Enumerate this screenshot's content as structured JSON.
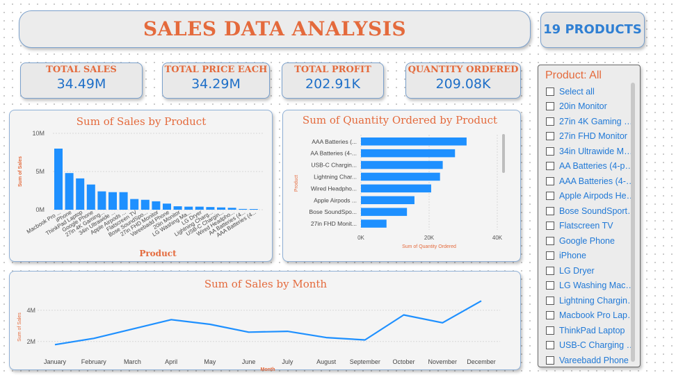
{
  "header": {
    "title": "SALES DATA ANALYSIS",
    "product_count": "19 PRODUCTS"
  },
  "kpis": [
    {
      "label": "TOTAL SALES",
      "value": "34.49M"
    },
    {
      "label": "TOTAL PRICE EACH",
      "value": "34.29M"
    },
    {
      "label": "TOTAL PROFIT",
      "value": "202.91K"
    },
    {
      "label": "QUANTITY ORDERED",
      "value": "209.08K"
    }
  ],
  "slicer": {
    "title": "Product: All",
    "items": [
      "Select all",
      "20in Monitor",
      "27in 4K Gaming Mo...",
      "27in FHD Monitor",
      "34in Ultrawide Mon...",
      "AA Batteries (4-pack)",
      "AAA Batteries (4-pa...",
      "Apple Airpods Hea...",
      "Bose SoundSport H...",
      "Flatscreen TV",
      "Google Phone",
      "iPhone",
      "LG Dryer",
      "LG Washing Machine",
      "Lightning Charging ...",
      "Macbook Pro Laptop",
      "ThinkPad Laptop",
      "USB-C Charging Ca...",
      "Vareebadd Phone"
    ]
  },
  "colors": {
    "accent": "#e46a3c",
    "bar": "#1e90ff",
    "value": "#1e6fc8"
  },
  "chart_data": [
    {
      "type": "bar",
      "title": "Sum of Sales by Product",
      "xlabel": "Product",
      "ylabel": "Sum of Sales",
      "ylim": [
        0,
        10000000
      ],
      "yticks": [
        "0M",
        "5M",
        "10M"
      ],
      "ytick_values": [
        0,
        5000000,
        10000000
      ],
      "categories": [
        "Macbook Pro ...",
        "iPhone",
        "ThinkPad Laptop",
        "Google Phone",
        "27in 4K Gaming...",
        "34in Ultrawide ...",
        "Apple Airpods ...",
        "Flatscreen TV",
        "Bose SoundSpo...",
        "27in FHD Monitor",
        "Vareebadd Phone",
        "20in Monitor",
        "LG Washing Ma...",
        "LG Dryer",
        "Lightning Charg...",
        "USB-C Chargin...",
        "Wired Headpho...",
        "AA Batteries (4...",
        "AAA Batteries (4..."
      ],
      "values": [
        8000000,
        4800000,
        4100000,
        3300000,
        2400000,
        2300000,
        2300000,
        1400000,
        1300000,
        1100000,
        800000,
        450000,
        400000,
        400000,
        350000,
        300000,
        250000,
        100000,
        90000
      ]
    },
    {
      "type": "bar",
      "orientation": "horizontal",
      "title": "Sum of Quantity Ordered by Product",
      "xlabel": "Sum of Quantity Ordered",
      "ylabel": "Product",
      "xlim": [
        0,
        40000
      ],
      "xticks": [
        "0K",
        "20K",
        "40K"
      ],
      "xtick_values": [
        0,
        20000,
        40000
      ],
      "categories": [
        "AAA Batteries (...",
        "AA Batteries (4-...",
        "USB-C Chargin...",
        "Lightning Char...",
        "Wired Headpho...",
        "Apple Airpods ...",
        "Bose SoundSpo...",
        "27in FHD Monit..."
      ],
      "values": [
        31000,
        27600,
        24000,
        23200,
        20600,
        15700,
        13500,
        7500
      ]
    },
    {
      "type": "line",
      "title": "Sum of Sales by Month",
      "xlabel": "Month",
      "ylabel": "Sum of Sales",
      "ylim": [
        1500000,
        4700000
      ],
      "yticks": [
        "2M",
        "4M"
      ],
      "ytick_values": [
        2000000,
        4000000
      ],
      "x": [
        "January",
        "February",
        "March",
        "April",
        "May",
        "June",
        "July",
        "August",
        "September",
        "October",
        "November",
        "December"
      ],
      "values": [
        1800000,
        2200000,
        2800000,
        3400000,
        3100000,
        2600000,
        2650000,
        2250000,
        2100000,
        3700000,
        3200000,
        4600000
      ]
    }
  ]
}
